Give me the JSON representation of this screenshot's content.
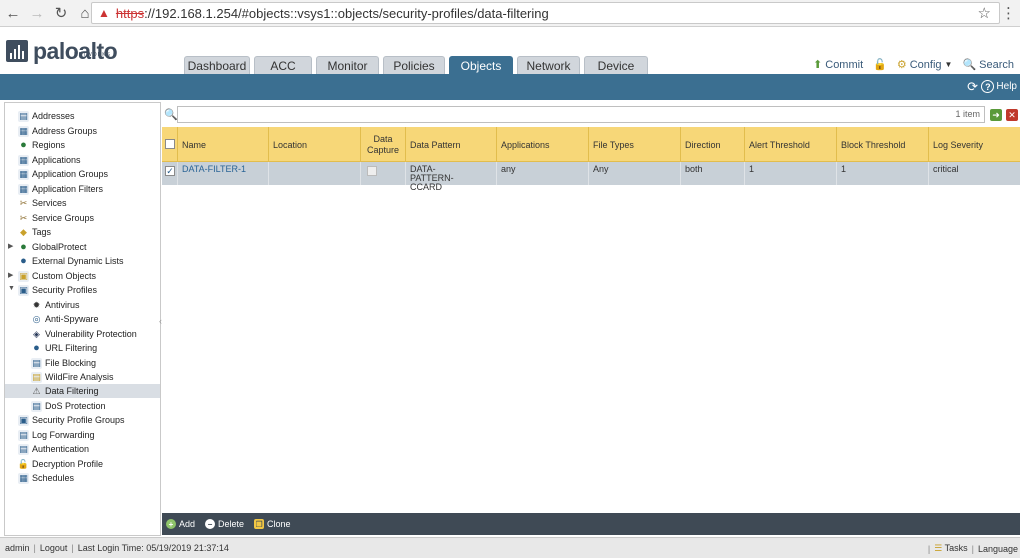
{
  "browser": {
    "url_scheme": "https",
    "url_rest": "://192.168.1.254/#objects::vsys1::objects/security-profiles/data-filtering"
  },
  "brand": {
    "name": "paloalto",
    "sub": "NETWORKS",
    "color": "#3f4d5e"
  },
  "tabs": [
    {
      "label": "Dashboard",
      "active": false
    },
    {
      "label": "ACC",
      "active": false
    },
    {
      "label": "Monitor",
      "active": false
    },
    {
      "label": "Policies",
      "active": false
    },
    {
      "label": "Objects",
      "active": true
    },
    {
      "label": "Network",
      "active": false
    },
    {
      "label": "Device",
      "active": false
    }
  ],
  "header_actions": {
    "commit": "Commit",
    "config": "Config",
    "search": "Search"
  },
  "help_label": "Help",
  "sidebar": {
    "items": [
      {
        "label": "Addresses",
        "icon": "address-icon"
      },
      {
        "label": "Address Groups",
        "icon": "address-groups-icon"
      },
      {
        "label": "Regions",
        "icon": "globe-icon"
      },
      {
        "label": "Applications",
        "icon": "applications-icon"
      },
      {
        "label": "Application Groups",
        "icon": "application-groups-icon"
      },
      {
        "label": "Application Filters",
        "icon": "application-filters-icon"
      },
      {
        "label": "Services",
        "icon": "services-icon"
      },
      {
        "label": "Service Groups",
        "icon": "service-groups-icon"
      },
      {
        "label": "Tags",
        "icon": "tag-icon"
      },
      {
        "label": "GlobalProtect",
        "icon": "globalprotect-icon"
      },
      {
        "label": "External Dynamic Lists",
        "icon": "external-lists-icon"
      },
      {
        "label": "Custom Objects",
        "icon": "custom-objects-icon"
      },
      {
        "label": "Security Profiles",
        "icon": "security-profiles-icon"
      },
      {
        "label": "Antivirus",
        "icon": "antivirus-icon"
      },
      {
        "label": "Anti-Spyware",
        "icon": "anti-spyware-icon"
      },
      {
        "label": "Vulnerability Protection",
        "icon": "vulnerability-icon"
      },
      {
        "label": "URL Filtering",
        "icon": "url-filtering-icon"
      },
      {
        "label": "File Blocking",
        "icon": "file-blocking-icon"
      },
      {
        "label": "WildFire Analysis",
        "icon": "wildfire-icon"
      },
      {
        "label": "Data Filtering",
        "icon": "data-filtering-icon"
      },
      {
        "label": "DoS Protection",
        "icon": "dos-protection-icon"
      },
      {
        "label": "Security Profile Groups",
        "icon": "profile-groups-icon"
      },
      {
        "label": "Log Forwarding",
        "icon": "log-forwarding-icon"
      },
      {
        "label": "Authentication",
        "icon": "authentication-icon"
      },
      {
        "label": "Decryption Profile",
        "icon": "decryption-icon"
      },
      {
        "label": "Schedules",
        "icon": "schedules-icon"
      }
    ]
  },
  "filter": {
    "count_text": "1 item"
  },
  "table": {
    "columns": [
      "Name",
      "Location",
      "Data Capture",
      "Data Pattern",
      "Applications",
      "File Types",
      "Direction",
      "Alert Threshold",
      "Block Threshold",
      "Log Severity"
    ],
    "rows": [
      {
        "name": "DATA-FILTER-1",
        "location": "",
        "data_pattern": "DATA-PATTERN-CCARD",
        "applications": "any",
        "file_types": "Any",
        "direction": "both",
        "alert_threshold": "1",
        "block_threshold": "1",
        "log_severity": "critical"
      }
    ]
  },
  "toolbar": {
    "add": "Add",
    "delete": "Delete",
    "clone": "Clone"
  },
  "status": {
    "user": "admin",
    "logout": "Logout",
    "last_login": "Last Login Time: 05/19/2019 21:37:14",
    "tasks": "Tasks",
    "language": "Language"
  }
}
